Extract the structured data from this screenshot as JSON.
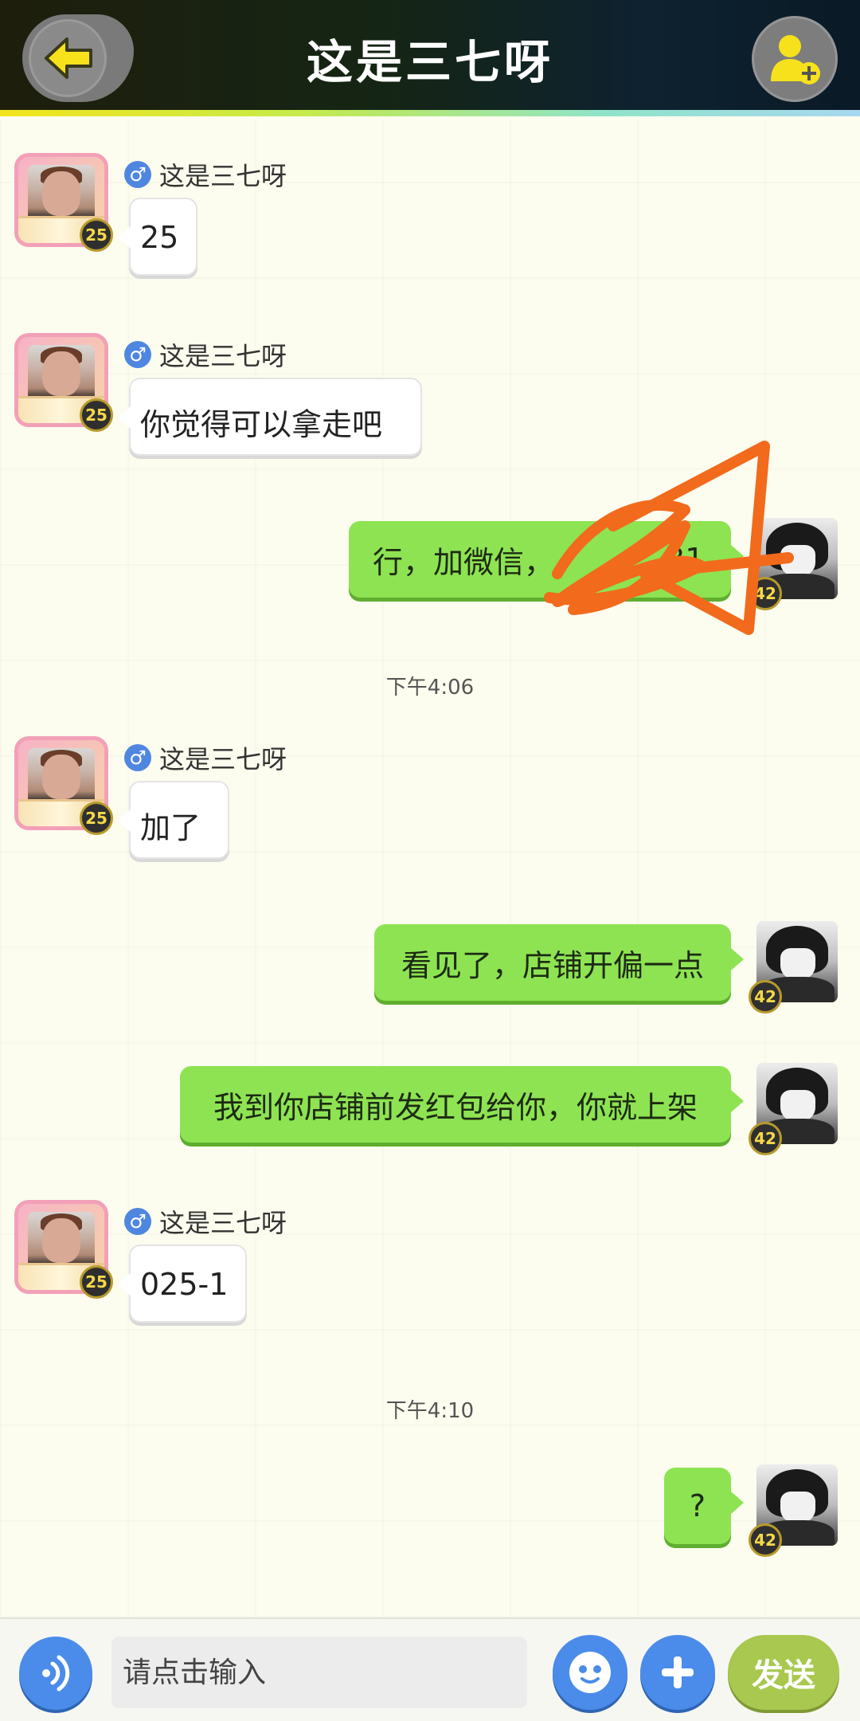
{
  "header": {
    "title": "这是三七呀",
    "back_icon": "arrow-left-icon",
    "add_friend_icon": "add-user-icon"
  },
  "messages": [
    {
      "sender": "这是三七呀",
      "text": "25",
      "side": "left",
      "level": "25",
      "gender": "♂"
    },
    {
      "sender": "这是三七呀",
      "text": "你觉得可以拿走吧",
      "side": "left",
      "level": "25",
      "gender": "♂"
    },
    {
      "text": "行，加微信，",
      "text_tail": "31",
      "side": "right",
      "level": "42"
    },
    {
      "sender": "这是三七呀",
      "text": "加了",
      "side": "left",
      "level": "25",
      "gender": "♂"
    },
    {
      "text": "看见了，店铺开偏一点",
      "side": "right",
      "level": "42"
    },
    {
      "text": "我到你店铺前发红包给你，你就上架",
      "side": "right",
      "level": "42"
    },
    {
      "sender": "这是三七呀",
      "text": "025-1",
      "side": "left",
      "level": "25",
      "gender": "♂"
    },
    {
      "text": "?",
      "side": "right",
      "level": "42"
    }
  ],
  "timestamps": [
    "下午4:06",
    "下午4:10"
  ],
  "input_bar": {
    "placeholder": "请点击输入",
    "send_label": "发送",
    "voice_icon": "voice-icon",
    "emoji_icon": "emoji-icon",
    "plus_icon": "plus-icon"
  },
  "colors": {
    "green_bubble": "#8ee352",
    "accent_blue": "#4b8cea",
    "send_button": "#a8c84f",
    "level_badge_text": "#f6d84a",
    "scribble": "#f26a1c"
  }
}
